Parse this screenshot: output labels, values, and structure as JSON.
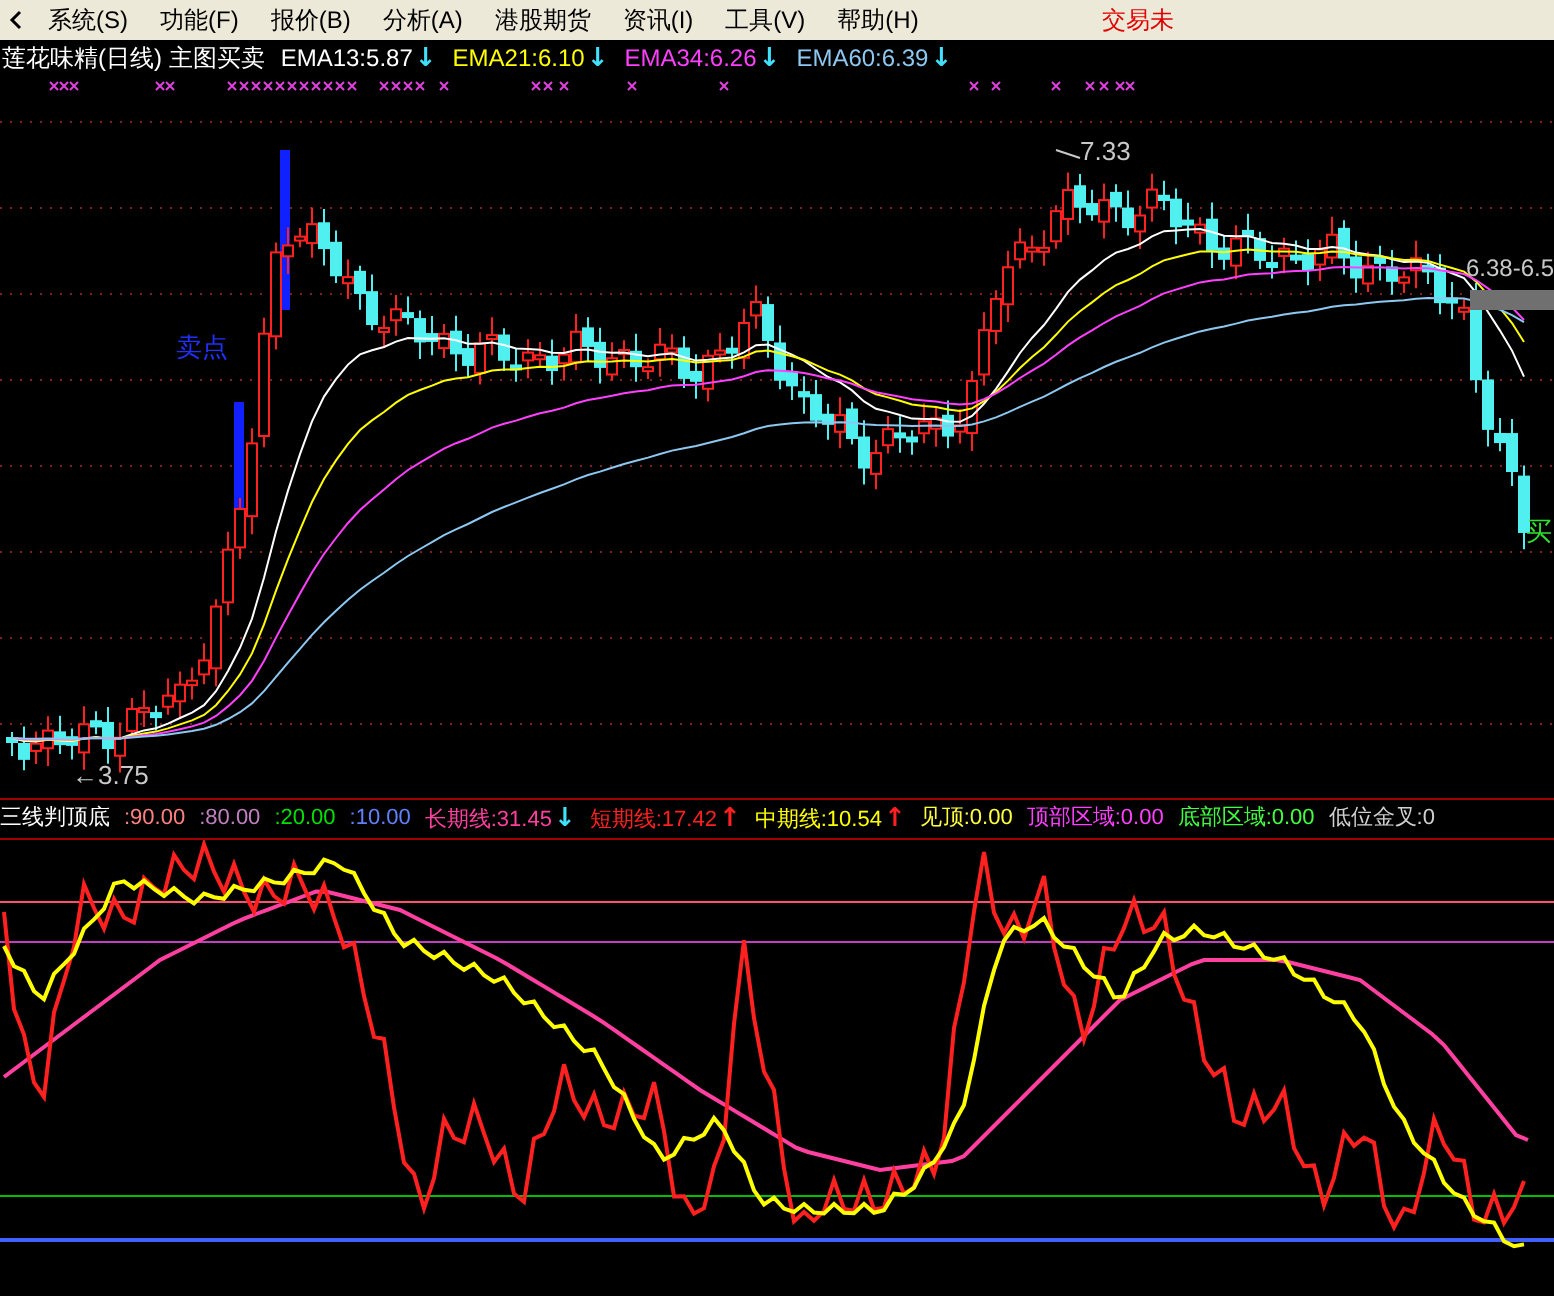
{
  "menu": {
    "items": [
      {
        "label": "系统(S)"
      },
      {
        "label": "功能(F)"
      },
      {
        "label": "报价(B)"
      },
      {
        "label": "分析(A)"
      },
      {
        "label": "港股期货"
      },
      {
        "label": "资讯(I)"
      },
      {
        "label": "工具(V)"
      },
      {
        "label": "帮助(H)"
      }
    ],
    "status": "交易未"
  },
  "main_chart": {
    "title": "莲花味精(日线) 主图买卖",
    "indicators": [
      {
        "label": "EMA13:5.87",
        "color": "#ffffff",
        "arrow": {
          "text": "↓",
          "color": "#40e0ff"
        }
      },
      {
        "label": "EMA21:6.10",
        "color": "#ffff00",
        "arrow": {
          "text": "↓",
          "color": "#40e0ff"
        }
      },
      {
        "label": "EMA34:6.26",
        "color": "#ff40ff",
        "arrow": {
          "text": "↓",
          "color": "#40e0ff"
        }
      },
      {
        "label": "EMA60:6.39",
        "color": "#8cc8f0",
        "arrow": {
          "text": "↓",
          "color": "#40e0ff"
        }
      }
    ],
    "price_labels": [
      {
        "kind": "high",
        "text": "7.33"
      },
      {
        "kind": "low",
        "text": "←3.75"
      },
      {
        "kind": "range",
        "text": "6.38-6.5"
      }
    ],
    "signals": [
      {
        "kind": "sell",
        "text": "卖点"
      },
      {
        "kind": "buy",
        "text": "买"
      }
    ]
  },
  "indicator_panel": {
    "items": [
      {
        "label": "三线判顶底",
        "color": "#ffffff"
      },
      {
        "label": ":90.00",
        "color": "#ff8080"
      },
      {
        "label": ":80.00",
        "color": "#c080c0"
      },
      {
        "label": ":20.00",
        "color": "#00e000"
      },
      {
        "label": ":10.00",
        "color": "#6080ff"
      },
      {
        "label": "长期线:31.45",
        "color": "#ff40a0",
        "arrow": {
          "text": "↓",
          "color": "#40e0ff"
        }
      },
      {
        "label": "短期线:17.42",
        "color": "#ff2020",
        "arrow": {
          "text": "↑",
          "color": "#ff2020"
        }
      },
      {
        "label": "中期线:10.54",
        "color": "#ffff00",
        "arrow": {
          "text": "↑",
          "color": "#ff2020"
        }
      },
      {
        "label": "见顶:0.00",
        "color": "#ffff40"
      },
      {
        "label": "顶部区域:0.00",
        "color": "#ff40ff"
      },
      {
        "label": "底部区域:0.00",
        "color": "#40ff40"
      },
      {
        "label": "低位金叉:0",
        "color": "#d0d0d0"
      }
    ]
  }
}
